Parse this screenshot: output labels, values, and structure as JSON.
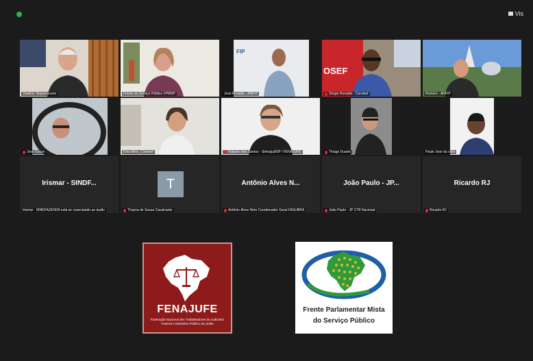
{
  "toolbar": {
    "view_label": "Vis"
  },
  "participants": [
    {
      "name": "Vladimir Nepomuceno",
      "muted": false
    },
    {
      "name": "Frente do Serviço Público FPMSP",
      "muted": false
    },
    {
      "name": "José Arinaldo - ANFIP",
      "muted": false
    },
    {
      "name": "Sérgio Ronaldo - Condsef",
      "muted": true
    },
    {
      "name": "Romero - ANFIP",
      "muted": false
    },
    {
      "name": "Jose Gozze",
      "muted": true
    },
    {
      "name": "Elna Melo_Condsef",
      "muted": false
    },
    {
      "name": "Fabiano dos Santos - Sintrajud/SP / FENAJUFE",
      "muted": true
    },
    {
      "name": "Thiago Duarte",
      "muted": true
    },
    {
      "name": "Paulo Jose da silva",
      "muted": false
    },
    {
      "display": "Irismar - SINDF...",
      "name": "Irismar - SINDFAZENDA está se conectando ao áudio",
      "muted": false
    },
    {
      "display": "T",
      "name": "Thayna de Souza Cavalcante",
      "muted": true
    },
    {
      "display": "Antônio Alves N...",
      "name": "Antônio Alves Neto Coordenador Geral FASUBRA",
      "muted": true
    },
    {
      "display": "João Paulo - JP...",
      "name": "João Paulo - JP CTB Nacional",
      "muted": true
    },
    {
      "display": "Ricardo RJ",
      "name": "Ricardo RJ",
      "muted": true
    }
  ],
  "logos": {
    "fenajufe": {
      "title": "FENAJUFE",
      "subtitle": "Federação Nacional dos Trabalhadores do Judiciário Federal e Ministério Público da União"
    },
    "frente": {
      "line1": "Frente Parlamentar Mista",
      "line2": "do Serviço Público"
    }
  },
  "colors": {
    "active_speaker": "#c9d04a",
    "fenajufe_red": "#8e1b1b",
    "frente_blue": "#1e5fa8",
    "frente_green": "#2f9a3a"
  }
}
